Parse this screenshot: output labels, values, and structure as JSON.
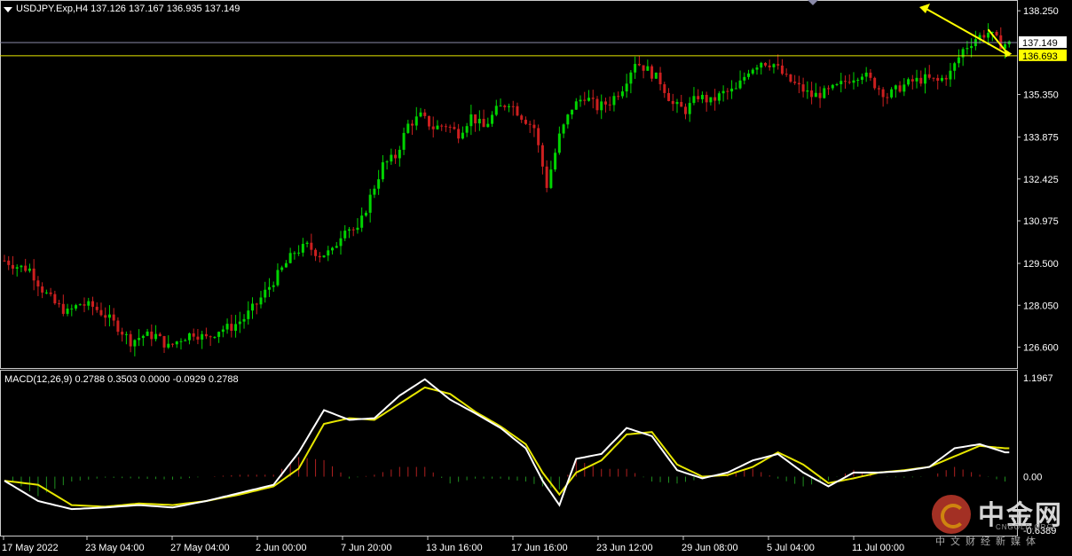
{
  "symbol_header": "USDJPY.Exp,H4  137.126 137.167 136.935 137.149",
  "macd_header": "MACD(12,26,9) 0.2788 0.3503 0.0000 -0.0929 0.2788",
  "price_labels": {
    "current": "137.149",
    "level": "136.693"
  },
  "price_axis_ticks": [
    "138.250",
    "135.350",
    "133.875",
    "132.425",
    "130.975",
    "129.500",
    "128.050",
    "126.600"
  ],
  "macd_axis_ticks": [
    "1.1967",
    "0.00",
    "-0.6389"
  ],
  "time_axis_ticks": [
    "17 May 2022",
    "23 May 04:00",
    "27 May 04:00",
    "2 Jun 00:00",
    "7 Jun 20:00",
    "13 Jun 16:00",
    "17 Jun 16:00",
    "23 Jun 12:00",
    "29 Jun 08:00",
    "5 Jul 04:00",
    "11 Jul 00:00"
  ],
  "watermark": {
    "name_cn": "中金网",
    "name_en": "CNGOLD.ORG",
    "tagline": "中文财经新媒体"
  },
  "colors": {
    "bull": "#00d400",
    "bear": "#cc1f1f",
    "macd_line": "#ffffff",
    "signal_line": "#e6e600",
    "level_line": "#e6e600",
    "arrow": "#ffff00"
  },
  "chart_data": [
    {
      "type": "line",
      "title": "USDJPY.Exp,H4",
      "ylim": [
        126.0,
        138.5
      ],
      "close_path": [
        [
          0,
          129.6
        ],
        [
          3,
          129.4
        ],
        [
          6,
          129.3
        ],
        [
          9,
          128.6
        ],
        [
          12,
          128.1
        ],
        [
          15,
          127.8
        ],
        [
          18,
          128.1
        ],
        [
          21,
          128.0
        ],
        [
          24,
          127.7
        ],
        [
          27,
          127.3
        ],
        [
          30,
          126.8
        ],
        [
          33,
          127.0
        ],
        [
          36,
          127.0
        ],
        [
          39,
          126.6
        ],
        [
          42,
          126.9
        ],
        [
          45,
          127.1
        ],
        [
          48,
          126.9
        ],
        [
          51,
          127.2
        ],
        [
          54,
          127.3
        ],
        [
          57,
          127.6
        ],
        [
          60,
          128.1
        ],
        [
          63,
          128.7
        ],
        [
          66,
          129.3
        ],
        [
          69,
          129.9
        ],
        [
          72,
          130.1
        ],
        [
          75,
          129.8
        ],
        [
          78,
          129.9
        ],
        [
          81,
          130.8
        ],
        [
          84,
          130.6
        ],
        [
          87,
          131.8
        ],
        [
          90,
          132.9
        ],
        [
          93,
          133.2
        ],
        [
          96,
          134.3
        ],
        [
          99,
          134.6
        ],
        [
          102,
          134.2
        ],
        [
          105,
          134.3
        ],
        [
          108,
          134.0
        ],
        [
          111,
          134.6
        ],
        [
          114,
          134.2
        ],
        [
          117,
          134.8
        ],
        [
          120,
          135.1
        ],
        [
          123,
          134.6
        ],
        [
          126,
          134.2
        ],
        [
          129,
          132.2
        ],
        [
          132,
          133.9
        ],
        [
          135,
          134.9
        ],
        [
          138,
          135.3
        ],
        [
          141,
          134.9
        ],
        [
          144,
          135.1
        ],
        [
          147,
          135.6
        ],
        [
          150,
          136.5
        ],
        [
          153,
          136.2
        ],
        [
          156,
          135.8
        ],
        [
          159,
          135.0
        ],
        [
          162,
          134.8
        ],
        [
          165,
          135.3
        ],
        [
          168,
          135.1
        ],
        [
          171,
          135.4
        ],
        [
          174,
          135.5
        ],
        [
          177,
          136.2
        ],
        [
          180,
          136.5
        ],
        [
          183,
          136.4
        ],
        [
          186,
          135.9
        ],
        [
          189,
          135.6
        ],
        [
          192,
          135.3
        ],
        [
          195,
          135.4
        ],
        [
          198,
          135.6
        ],
        [
          201,
          135.9
        ],
        [
          204,
          136.1
        ],
        [
          207,
          135.7
        ],
        [
          210,
          135.3
        ],
        [
          213,
          135.6
        ],
        [
          216,
          135.8
        ],
        [
          219,
          135.9
        ],
        [
          222,
          135.8
        ],
        [
          225,
          136.1
        ],
        [
          228,
          136.9
        ],
        [
          231,
          137.3
        ],
        [
          234,
          137.5
        ],
        [
          237,
          137.1
        ]
      ],
      "current_price": 137.149,
      "level": 136.693
    },
    {
      "type": "line",
      "title": "MACD(12,26,9)",
      "ylim": [
        -0.6389,
        1.1967
      ],
      "series": [
        {
          "name": "MACD",
          "x": [
            0,
            8,
            16,
            24,
            32,
            40,
            48,
            56,
            64,
            70,
            76,
            82,
            88,
            94,
            100,
            106,
            112,
            118,
            124,
            128,
            132,
            136,
            142,
            148,
            154,
            160,
            166,
            172,
            178,
            184,
            190,
            196,
            202,
            208,
            214,
            220,
            226,
            232,
            238
          ],
          "values": [
            -0.05,
            -0.3,
            -0.4,
            -0.38,
            -0.35,
            -0.38,
            -0.3,
            -0.2,
            -0.1,
            0.3,
            0.82,
            0.7,
            0.72,
            1.0,
            1.2,
            0.95,
            0.78,
            0.6,
            0.35,
            -0.05,
            -0.35,
            0.22,
            0.28,
            0.6,
            0.5,
            0.08,
            -0.02,
            0.05,
            0.2,
            0.28,
            0.05,
            -0.12,
            0.05,
            0.05,
            0.07,
            0.12,
            0.35,
            0.4,
            0.3
          ]
        },
        {
          "name": "Signal",
          "x": [
            0,
            8,
            16,
            24,
            32,
            40,
            48,
            56,
            64,
            70,
            76,
            82,
            88,
            94,
            100,
            106,
            112,
            118,
            124,
            128,
            132,
            136,
            142,
            148,
            154,
            160,
            166,
            172,
            178,
            184,
            190,
            196,
            202,
            208,
            214,
            220,
            226,
            232,
            238
          ],
          "values": [
            -0.05,
            -0.1,
            -0.35,
            -0.37,
            -0.33,
            -0.35,
            -0.3,
            -0.22,
            -0.12,
            0.1,
            0.65,
            0.72,
            0.7,
            0.9,
            1.1,
            1.02,
            0.8,
            0.62,
            0.4,
            0.05,
            -0.22,
            0.05,
            0.2,
            0.52,
            0.55,
            0.15,
            0.0,
            0.02,
            0.12,
            0.3,
            0.15,
            -0.08,
            -0.02,
            0.05,
            0.08,
            0.12,
            0.25,
            0.38,
            0.35
          ]
        }
      ]
    }
  ]
}
